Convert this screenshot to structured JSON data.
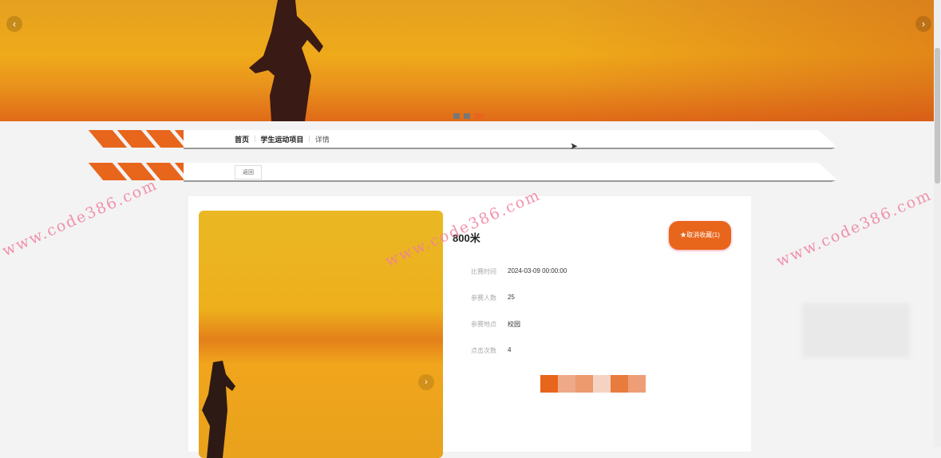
{
  "banner": {
    "prev": "‹",
    "next": "›",
    "slides": 3,
    "active_slide": 3
  },
  "breadcrumb": {
    "items": [
      "首页",
      "学生运动项目",
      "详情"
    ],
    "sep": "|"
  },
  "back_button": "返回",
  "detail": {
    "title": "800米",
    "favorite_button": "★取消收藏(1)",
    "fields": [
      {
        "label": "比赛时间",
        "value": "2024-03-09 00:00:00"
      },
      {
        "label": "参赛人数",
        "value": "25"
      },
      {
        "label": "参赛地点",
        "value": "校园"
      },
      {
        "label": "点击次数",
        "value": "4"
      }
    ],
    "image_next": "›"
  },
  "watermark": "www.code386.com",
  "colors": {
    "accent": "#e8651c"
  }
}
